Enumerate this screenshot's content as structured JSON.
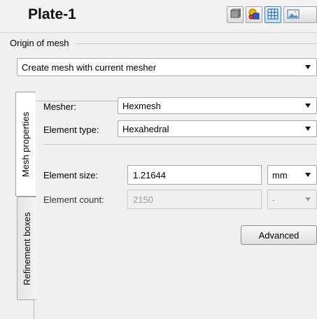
{
  "header": {
    "title": "Plate-1",
    "toolbar": [
      {
        "icon": "solid-view-icon"
      },
      {
        "icon": "material-icon"
      },
      {
        "icon": "mesh-view-icon"
      },
      {
        "icon": "image-icon"
      }
    ]
  },
  "origin": {
    "label": "Origin of mesh",
    "option": "Create mesh with current mesher"
  },
  "tabs": [
    {
      "label": "Mesh properties",
      "active": true
    },
    {
      "label": "Refinement boxes",
      "active": false
    }
  ],
  "mesh": {
    "mesher_label": "Mesher:",
    "mesher_value": "Hexmesh",
    "element_type_label": "Element type:",
    "element_type_value": "Hexahedral",
    "element_size_label": "Element size:",
    "element_size_value": "1.21644",
    "element_size_unit": "mm",
    "element_count_label": "Element count:",
    "element_count_value": "2150",
    "element_count_unit": "-",
    "advanced_label": "Advanced"
  },
  "colors": {
    "background": "#f0f0f0",
    "active_tool": "#bfe0f7"
  }
}
